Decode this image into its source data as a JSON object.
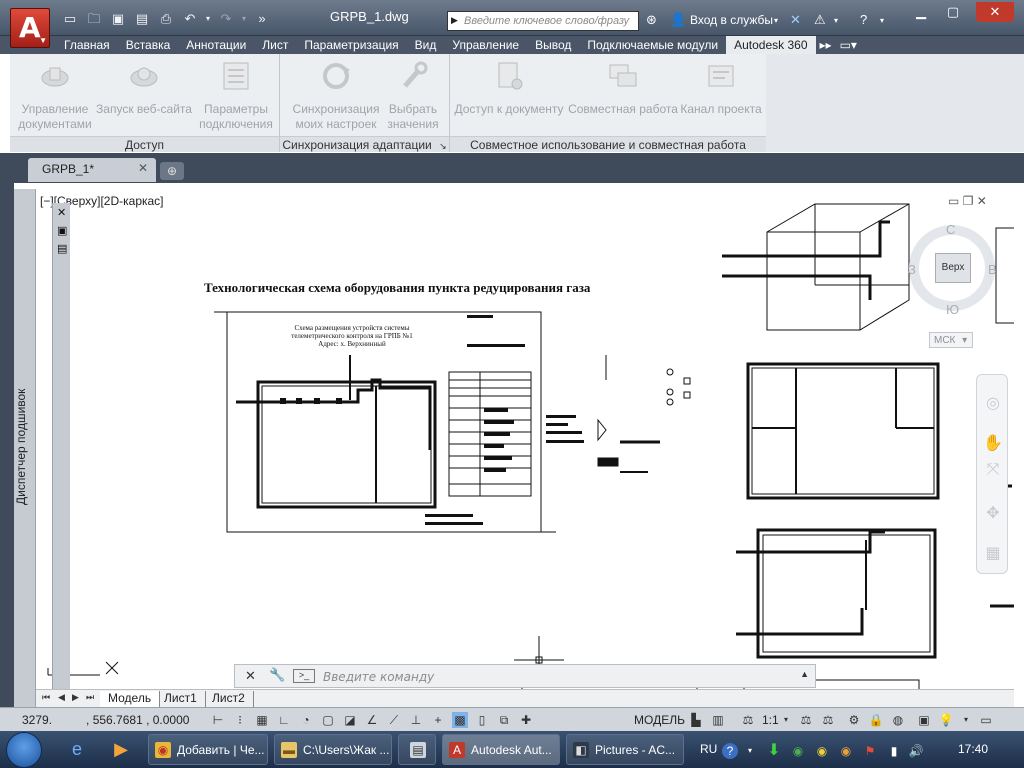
{
  "window": {
    "title": "GRPB_1.dwg",
    "search_placeholder": "Введите ключевое слово/фразу",
    "login_label": "Вход в службы"
  },
  "ribbon_tabs": [
    "Главная",
    "Вставка",
    "Аннотации",
    "Лист",
    "Параметризация",
    "Вид",
    "Управление",
    "Вывод",
    "Подключаемые модули",
    "Autodesk 360"
  ],
  "ribbon_active_tab": "Autodesk 360",
  "ribbon_groups": {
    "access": {
      "title": "Доступ",
      "buttons": [
        {
          "line1": "Управление",
          "line2": "документами",
          "icon": "cloud-docs-icon"
        },
        {
          "line1": "Запуск веб-сайта",
          "line2": "",
          "icon": "cloud-web-icon"
        },
        {
          "line1": "Параметры",
          "line2": "подключения",
          "icon": "connection-settings-icon"
        }
      ]
    },
    "sync": {
      "title": "Синхронизация адаптации",
      "buttons": [
        {
          "line1": "Синхронизация",
          "line2": "моих настроек",
          "icon": "sync-icon"
        },
        {
          "line1": "Выбрать",
          "line2": "значения",
          "icon": "wrench-icon"
        }
      ]
    },
    "collab": {
      "title": "Совместное использование и совместная работа",
      "buttons": [
        {
          "line1": "Доступ к документу",
          "line2": "",
          "icon": "share-doc-icon"
        },
        {
          "line1": "Совместная работа",
          "line2": "",
          "icon": "collab-icon"
        },
        {
          "line1": "Канал проекта",
          "line2": "",
          "icon": "project-feed-icon"
        }
      ]
    }
  },
  "document_tab": "GRPB_1*",
  "sheet_set_palette": "Диспетчер подшивок",
  "viewport_label": "[−][Сверху][2D-каркас]",
  "drawing": {
    "title": "Технологическая схема оборудования пункта редуцирования газа",
    "scheme_caption_1": "Схема размещения устройств системы",
    "scheme_caption_2": "телеметрического контроля на ГРПБ №1",
    "scheme_caption_3": "Адрес: х. Верхнинный"
  },
  "viewcube": {
    "north": "С",
    "south": "Ю",
    "west": "З",
    "east": "В",
    "top_face": "Верх",
    "wcs": "МСК"
  },
  "command_line": {
    "placeholder": "Введите команду"
  },
  "layout_tabs": [
    "Модель",
    "Лист1",
    "Лист2"
  ],
  "status": {
    "coords_x": "3279.",
    "coords_rest": ", 556.7681 , 0.0000",
    "model": "МОДЕЛЬ",
    "scale": "1:1"
  },
  "taskbar": {
    "tasks": [
      {
        "label": "Добавить | Че...",
        "icon": "chrome-icon",
        "active": false
      },
      {
        "label": "C:\\Users\\Жак ...",
        "icon": "folder-icon",
        "active": false
      },
      {
        "label": "",
        "icon": "calculator-icon",
        "active": false
      },
      {
        "label": "Autodesk Aut...",
        "icon": "autocad-icon",
        "active": true
      },
      {
        "label": "Pictures - AC...",
        "icon": "acdsee-icon",
        "active": false
      }
    ],
    "lang": "RU",
    "clock": "17:40"
  }
}
